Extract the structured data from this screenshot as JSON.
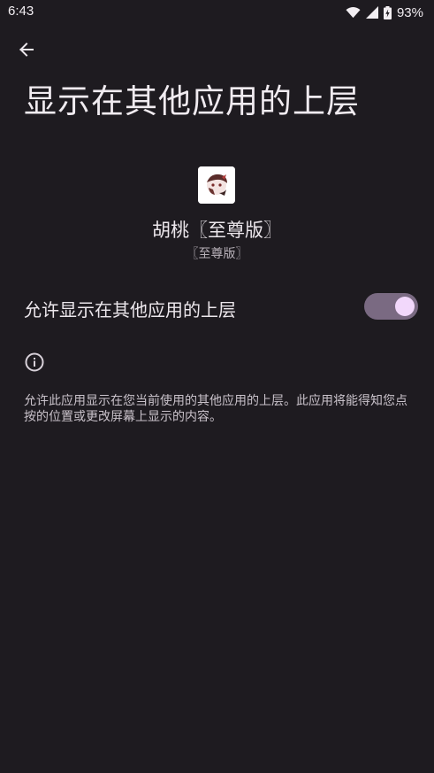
{
  "status_bar": {
    "time": "6:43",
    "battery_percent": "93%",
    "icons": [
      "wifi-icon",
      "signal-icon",
      "battery-charging-icon"
    ]
  },
  "header": {
    "back_icon": "arrow-back-icon",
    "title": "显示在其他应用的上层"
  },
  "app": {
    "name": "胡桃〖至尊版〗",
    "subname": "〖至尊版〗"
  },
  "permission": {
    "label": "允许显示在其他应用的上层",
    "enabled": true
  },
  "info": {
    "icon": "info-icon",
    "description": "允许此应用显示在您当前使用的其他应用的上层。此应用将能得知您点按的位置或更改屏幕上显示的内容。"
  },
  "colors": {
    "background": "#1e1b20",
    "toggle_track": "#7a6a82",
    "toggle_thumb": "#f2d8fb"
  }
}
